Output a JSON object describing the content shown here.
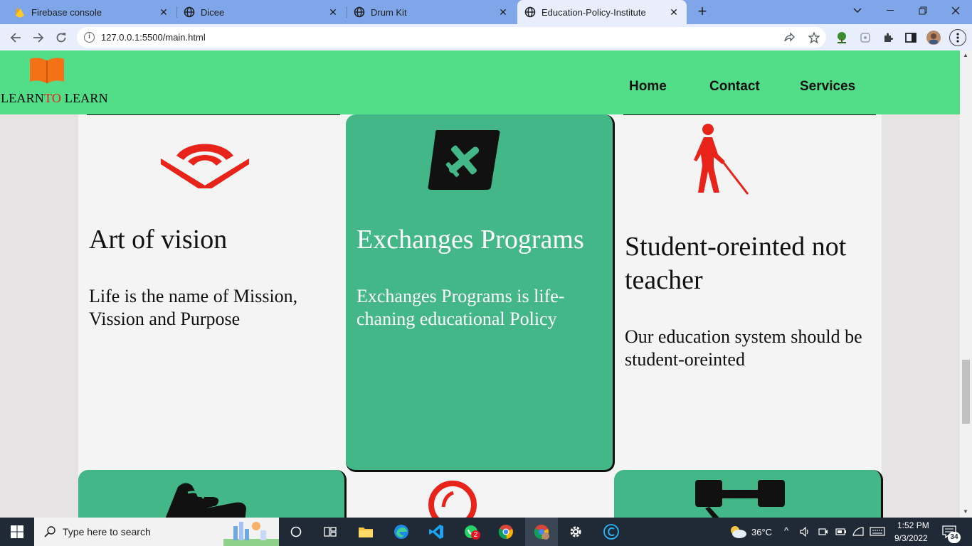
{
  "browser": {
    "tabs": [
      {
        "title": "Firebase console",
        "favicon": "firebase-icon"
      },
      {
        "title": "Dicee",
        "favicon": "globe-icon"
      },
      {
        "title": "Drum Kit",
        "favicon": "globe-icon"
      },
      {
        "title": "Education-Policy-Institute",
        "favicon": "globe-icon",
        "active": true
      }
    ],
    "url": "127.0.0.1:5500/main.html"
  },
  "site": {
    "logo": {
      "part1": "LEARN",
      "accent": "TO",
      "part2": " LEARN",
      "accent_color": "#e8231a",
      "book_color": "#f47216"
    },
    "nav": [
      "Home",
      "Contact",
      "Services"
    ],
    "header_color": "#52dd88"
  },
  "cards": [
    {
      "title": "Art of vision",
      "text": "Life is the name of Mission, Vission and Purpose",
      "icon": "audible-icon",
      "style": "light"
    },
    {
      "title": "Exchanges Programs",
      "text": "Exchanges Programs is life-chaning educational Policy",
      "icon": "airplane-icon",
      "style": "green"
    },
    {
      "title": "Student-oreinted not teacher",
      "text": "Our education system should be student-oreinted",
      "icon": "blind-person-icon",
      "style": "light"
    }
  ],
  "lower_cards": [
    {
      "icon": "sign-language-icon",
      "style": "green"
    },
    {
      "icon": "ring-icon",
      "style": "light"
    },
    {
      "icon": "gavel-icon",
      "style": "green"
    }
  ],
  "colors": {
    "card_green": "#43b787",
    "icon_red": "#e8231a"
  },
  "taskbar": {
    "search_placeholder": "Type here to search",
    "weather": "36°C",
    "time": "1:52 PM",
    "date": "9/3/2022",
    "notifications": "34",
    "whatsapp_badge": "2"
  }
}
